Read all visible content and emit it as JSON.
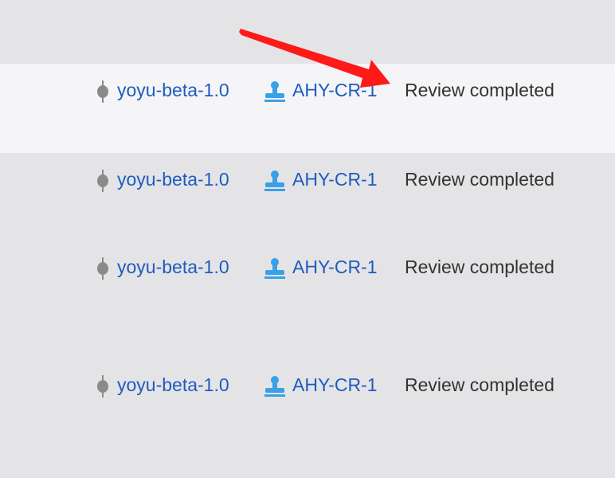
{
  "rows": [
    {
      "version": "yoyu-beta-1.0",
      "review_id": "AHY-CR-1",
      "status": "Review completed"
    },
    {
      "version": "yoyu-beta-1.0",
      "review_id": "AHY-CR-1",
      "status": "Review completed"
    },
    {
      "version": "yoyu-beta-1.0",
      "review_id": "AHY-CR-1",
      "status": "Review completed"
    },
    {
      "version": "yoyu-beta-1.0",
      "review_id": "AHY-CR-1",
      "status": "Review completed"
    }
  ],
  "icons": {
    "version": "commit-icon",
    "review": "stamp-icon",
    "annotation": "red-arrow-icon"
  },
  "colors": {
    "background": "#e4e4e6",
    "highlight_row": "#f5f5f7",
    "link": "#1f5bbf",
    "status_text": "#333333",
    "commit_icon": "#8a8a8a",
    "stamp_icon": "#3aa0e8",
    "arrow": "#ff1a1a"
  }
}
